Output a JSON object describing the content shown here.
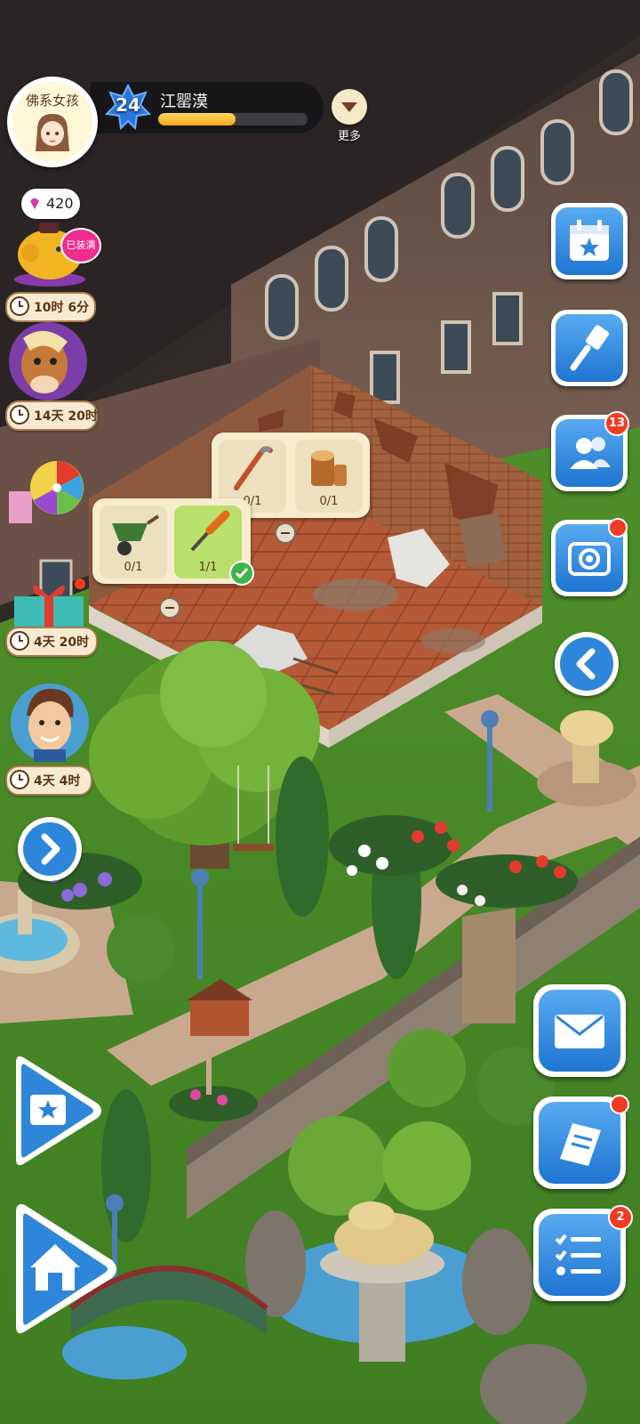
{
  "player": {
    "avatar_caption": "佛系女孩",
    "level": "24",
    "name": "江罂漠",
    "xp_progress": 0.52
  },
  "header": {
    "more_label": "更多"
  },
  "left_events": {
    "gems": "420",
    "piggy_badge": "已装满",
    "piggy_timer": "10时 6分",
    "horse_timer": "14天 20时",
    "gift_timer": "4天 20时",
    "character_timer": "4天 4时"
  },
  "right_buttons": {
    "friends_badge": "13",
    "tasks_badge": "2"
  },
  "tasks": {
    "crowbar": "0/1",
    "wood": "0/1",
    "wheelbarrow": "0/1",
    "screwdriver": "1/1"
  },
  "icons": [
    "calendar-star-icon",
    "brush-icon",
    "friends-icon",
    "gallery-icon",
    "back-arrow-icon",
    "mail-icon",
    "journal-icon",
    "checklist-icon",
    "home-icon",
    "forward-arrow-icon"
  ],
  "colors": {
    "button_blue": "#2d86d9",
    "badge_red": "#f03b25",
    "xp_gold": "#f0a816"
  }
}
